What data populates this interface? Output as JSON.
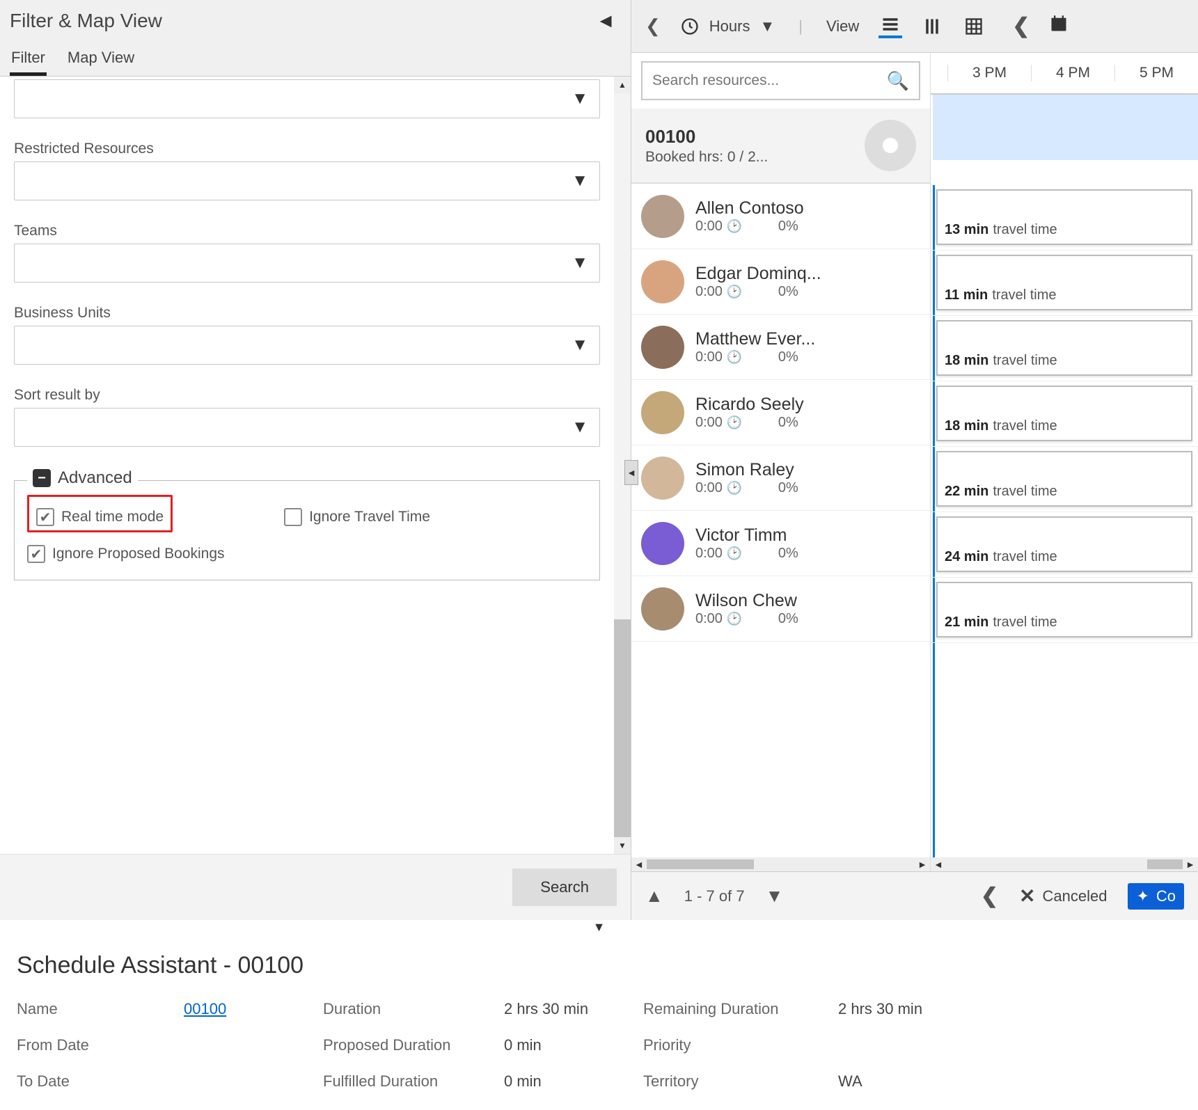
{
  "left": {
    "title": "Filter & Map View",
    "tabs": {
      "filter": "Filter",
      "map": "Map View"
    },
    "fields": {
      "restricted": "Restricted Resources",
      "teams": "Teams",
      "bu": "Business Units",
      "sort": "Sort result by"
    },
    "advanced": {
      "title": "Advanced",
      "realtime": "Real time mode",
      "ignore_travel": "Ignore Travel Time",
      "ignore_proposed": "Ignore Proposed Bookings"
    },
    "search_btn": "Search"
  },
  "toolbar": {
    "hours": "Hours",
    "view": "View"
  },
  "resources": {
    "search_placeholder": "Search resources...",
    "header_id": "00100",
    "header_sub": "Booked hrs: 0 / 2...",
    "list": [
      {
        "name": "Allen Contoso",
        "time": "0:00",
        "pct": "0%",
        "travel": "13 min"
      },
      {
        "name": "Edgar Dominq...",
        "time": "0:00",
        "pct": "0%",
        "travel": "11 min"
      },
      {
        "name": "Matthew Ever...",
        "time": "0:00",
        "pct": "0%",
        "travel": "18 min"
      },
      {
        "name": "Ricardo Seely",
        "time": "0:00",
        "pct": "0%",
        "travel": "18 min"
      },
      {
        "name": "Simon Raley",
        "time": "0:00",
        "pct": "0%",
        "travel": "22 min"
      },
      {
        "name": "Victor Timm",
        "time": "0:00",
        "pct": "0%",
        "travel": "24 min"
      },
      {
        "name": "Wilson Chew",
        "time": "0:00",
        "pct": "0%",
        "travel": "21 min"
      }
    ],
    "travel_label": "travel time"
  },
  "time_header": [
    "3 PM",
    "4 PM",
    "5 PM"
  ],
  "paging": {
    "text": "1 - 7 of 7"
  },
  "status": {
    "canceled": "Canceled",
    "co": "Co"
  },
  "assistant": {
    "title": "Schedule Assistant - 00100",
    "rows": [
      {
        "l1": "Name",
        "v1": "00100",
        "l2": "Duration",
        "v2": "2 hrs 30 min",
        "l3": "Remaining Duration",
        "v3": "2 hrs 30 min",
        "links": [
          1
        ]
      },
      {
        "l1": "From Date",
        "v1": "",
        "l2": "Proposed Duration",
        "v2": "0 min",
        "l3": "Priority",
        "v3": "",
        "links": []
      },
      {
        "l1": "To Date",
        "v1": "",
        "l2": "Fulfilled Duration",
        "v2": "0 min",
        "l3": "Territory",
        "v3": "WA",
        "links": [
          6
        ]
      }
    ]
  },
  "avatar_colors": [
    "#b49d8a",
    "#d8a47f",
    "#8a6d5a",
    "#c4a87a",
    "#d2b79a",
    "#7a5cd4",
    "#a88c6f"
  ]
}
